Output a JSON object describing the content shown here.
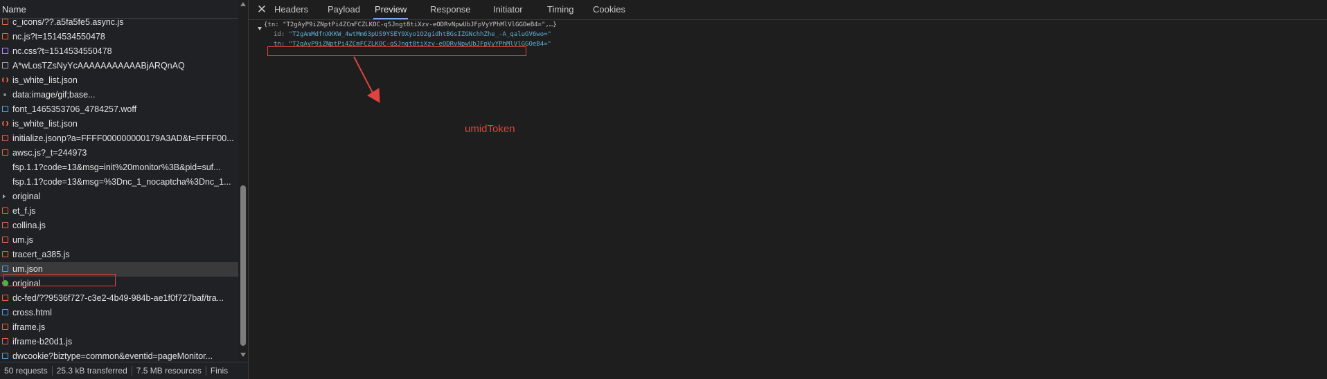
{
  "network_list": {
    "header": "Name",
    "rows": [
      {
        "name": "c_icons/??.a5fa5fe5.async.js",
        "icon": "js-file-icon",
        "kind": "js"
      },
      {
        "name": "nc.js?t=1514534550478",
        "icon": "js-file-icon",
        "kind": "js"
      },
      {
        "name": "nc.css?t=1514534550478",
        "icon": "css-file-icon",
        "kind": "css"
      },
      {
        "name": "A*wLosTZsNyYcAAAAAAAAAAABjARQnAQ",
        "icon": "image-file-icon",
        "kind": "img"
      },
      {
        "name": "is_white_list.json",
        "icon": "json-file-icon",
        "kind": "json"
      },
      {
        "name": "data:image/gif;base...",
        "icon": "data-uri-icon",
        "kind": "dot"
      },
      {
        "name": "font_1465353706_4784257.woff",
        "icon": "font-file-icon",
        "kind": "font"
      },
      {
        "name": "is_white_list.json",
        "icon": "json-file-icon",
        "kind": "json"
      },
      {
        "name": "initialize.jsonp?a=FFFF000000000179A3AD&t=FFFF00...",
        "icon": "js-file-icon",
        "kind": "js"
      },
      {
        "name": "awsc.js?_t=244973",
        "icon": "js-file-icon",
        "kind": "js"
      },
      {
        "name": "fsp.1.1?code=13&msg=init%20monitor%3B&pid=suf...",
        "icon": "blank-icon",
        "kind": "none"
      },
      {
        "name": "fsp.1.1?code=13&msg=%3Dnc_1_nocaptcha%3Dnc_1...",
        "icon": "blank-icon",
        "kind": "none"
      },
      {
        "name": "original",
        "icon": "redirect-arrow-icon",
        "kind": "arrow"
      },
      {
        "name": "et_f.js",
        "icon": "js-file-icon",
        "kind": "js"
      },
      {
        "name": "collina.js",
        "icon": "js-file-icon",
        "kind": "js"
      },
      {
        "name": "um.js",
        "icon": "js-file-icon",
        "kind": "js"
      },
      {
        "name": "tracert_a385.js",
        "icon": "js-file-icon",
        "kind": "js"
      },
      {
        "name": "um.json",
        "icon": "document-icon",
        "kind": "doc",
        "selected": true
      },
      {
        "name": "original",
        "icon": "green-circle-icon",
        "kind": "green"
      },
      {
        "name": "dc-fed/??9536f727-c3e2-4b49-984b-ae1f0f727baf/tra...",
        "icon": "js-file-icon",
        "kind": "js"
      },
      {
        "name": "cross.html",
        "icon": "document-icon",
        "kind": "doc"
      },
      {
        "name": "iframe.js",
        "icon": "js-file-icon",
        "kind": "js"
      },
      {
        "name": "iframe-b20d1.js",
        "icon": "js-file-icon",
        "kind": "js"
      },
      {
        "name": "dwcookie?biztype=common&eventid=pageMonitor...",
        "icon": "document-icon",
        "kind": "doc"
      }
    ]
  },
  "status_bar": {
    "requests": "50 requests",
    "transferred": "25.3 kB transferred",
    "resources": "7.5 MB resources",
    "finish": "Finis"
  },
  "detail_tabs": {
    "close_glyph": "✕",
    "tabs": [
      "Headers",
      "Payload",
      "Preview",
      "Response",
      "Initiator",
      "Timing",
      "Cookies"
    ],
    "active": "Preview"
  },
  "preview": {
    "summary": "{tn: \"T2gAyP9iZNptPi4ZCmFCZLKOC-qSJngt8tiXzv-eODRvNpwUbJFpVyYPhMlVlGGOeB4=\",…}",
    "id_key": "id:",
    "id_value": "\"T2gAmMdfnXKKW_4wtMm63pUS9YSEY9Xyo1O2gidhtBGsIZGNchhZhe_-A_qaluGV6wo=\"",
    "tn_key": "tn:",
    "tn_value": "\"T2gAyP9iZNptPi4ZCmFCZLKOC-qSJngt8tiXzv-eODRvNpwUbJFpVyYPhMlVlGGOeB4=\""
  },
  "annotation": {
    "label": "umidToken",
    "color": "#e0443e"
  },
  "colors": {
    "background": "#202124",
    "accent_tab": "#7cacf8",
    "string_value": "#5db0d7",
    "annotation_red": "#e0443e"
  }
}
